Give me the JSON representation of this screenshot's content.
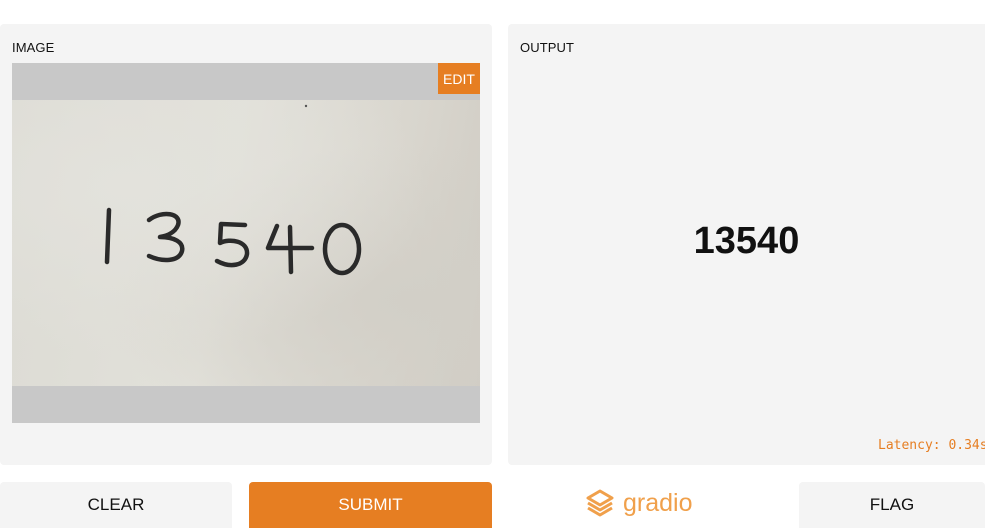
{
  "input": {
    "label": "IMAGE",
    "edit_label": "EDIT",
    "image_text": "13540"
  },
  "output": {
    "label": "OUTPUT",
    "value": "13540",
    "latency": "Latency: 0.34s"
  },
  "actions": {
    "clear_label": "CLEAR",
    "submit_label": "SUBMIT",
    "flag_label": "FLAG"
  },
  "brand": {
    "name": "gradio",
    "icon": "gradio-logo-icon"
  },
  "colors": {
    "accent": "#e67e22",
    "panel": "#f4f4f4",
    "logo": "#f0a04b"
  }
}
